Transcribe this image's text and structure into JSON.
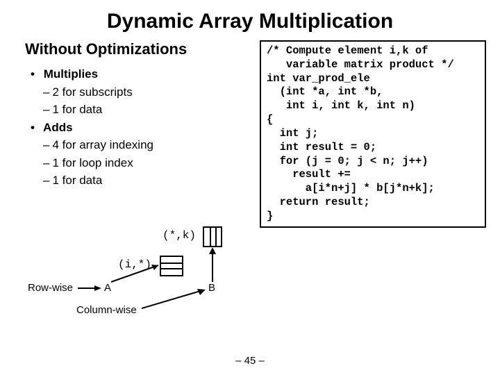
{
  "title": "Dynamic Array Multiplication",
  "left": {
    "heading": "Without Optimizations",
    "items": [
      {
        "label": "Multiplies",
        "sub": [
          "2 for subscripts",
          "1 for data"
        ]
      },
      {
        "label": "Adds",
        "sub": [
          "4 for array indexing",
          "1 for loop index",
          "1 for data"
        ]
      }
    ]
  },
  "code": "/* Compute element i,k of\n   variable matrix product */\nint var_prod_ele\n  (int *a, int *b,\n   int i, int k, int n)\n{\n  int j;\n  int result = 0;\n  for (j = 0; j < n; j++)\n    result +=\n      a[i*n+j] * b[j*n+k];\n  return result;\n}",
  "diagram": {
    "labelA": "A",
    "labelB": "B",
    "rowwise": "Row-wise",
    "colwise": "Column-wise",
    "idxA": "(i,*)",
    "idxB": "(*,k)"
  },
  "page": "– 45 –"
}
